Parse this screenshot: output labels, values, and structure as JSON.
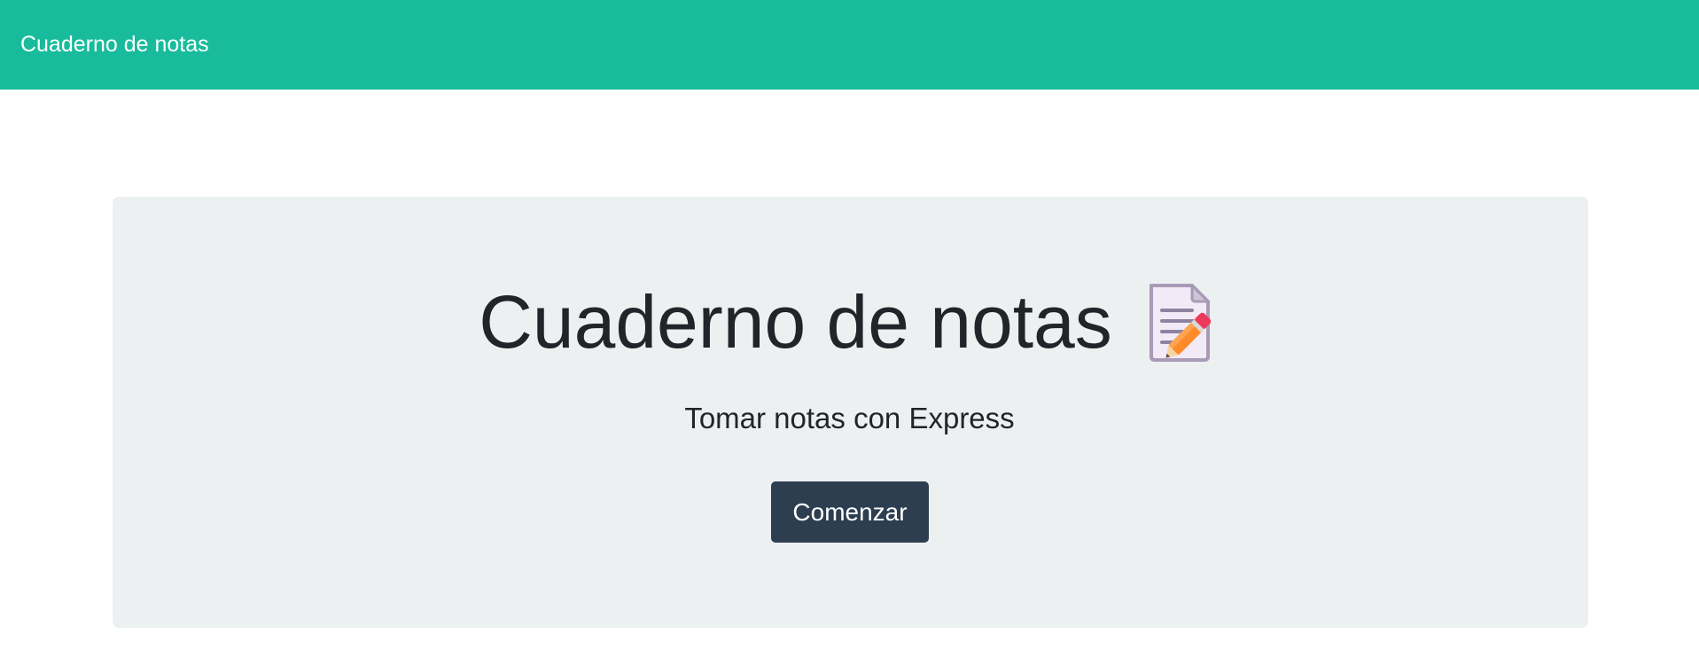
{
  "navbar": {
    "brand": "Cuaderno de notas",
    "background_color": "#18bc9c"
  },
  "hero": {
    "title": "Cuaderno de notas",
    "title_icon": "notepad-pencil-icon",
    "subtitle": "Tomar notas con Express",
    "button_label": "Comenzar",
    "panel_color": "#ecf0f1",
    "button_color": "#2c3e50"
  }
}
